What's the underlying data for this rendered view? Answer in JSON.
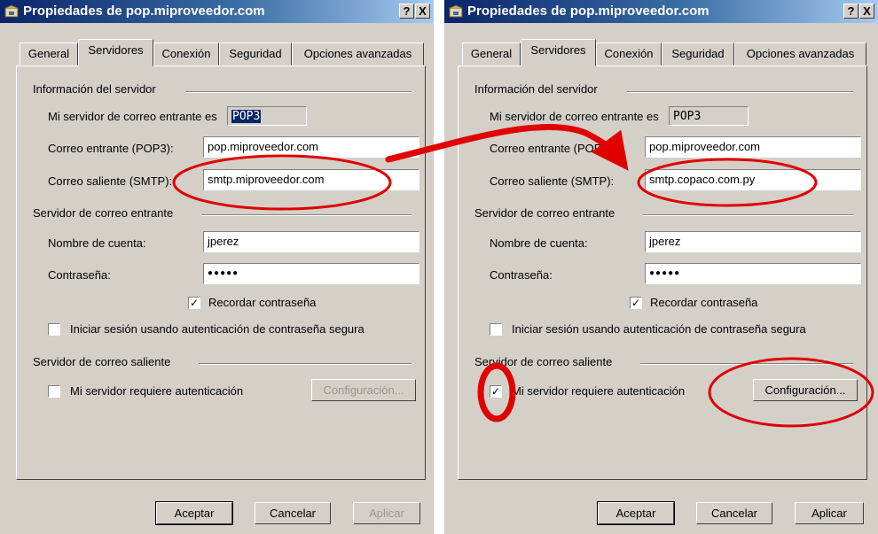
{
  "dialogs": [
    {
      "title": "Propiedades de pop.miproveedor.com",
      "help_btn": "?",
      "close_btn": "X",
      "tabs": [
        "General",
        "Servidores",
        "Conexión",
        "Seguridad",
        "Opciones avanzadas"
      ],
      "active_tab": "Servidores",
      "server_info_label": "Información del servidor",
      "incoming_type_label": "Mi servidor de correo entrante es",
      "incoming_type_value": "POP3",
      "pop3_label": "Correo entrante (POP3):",
      "pop3_value": "pop.miproveedor.com",
      "smtp_label": "Correo saliente (SMTP):",
      "smtp_value": "smtp.miproveedor.com",
      "incoming_server_label": "Servidor de correo entrante",
      "account_label": "Nombre de cuenta:",
      "account_value": "jperez",
      "password_label": "Contraseña:",
      "password_value": "●●●●●",
      "remember_label": "Recordar contraseña",
      "remember_checked": true,
      "spa_label": "Iniciar sesión usando autenticación de contraseña segura",
      "spa_checked": false,
      "outgoing_server_label": "Servidor de correo saliente",
      "auth_label": "Mi servidor requiere autenticación",
      "auth_checked": false,
      "config_btn": "Configuración...",
      "config_enabled": false,
      "ok_btn": "Aceptar",
      "cancel_btn": "Cancelar",
      "apply_btn": "Aplicar",
      "apply_enabled": false
    },
    {
      "title": "Propiedades de pop.miproveedor.com",
      "help_btn": "?",
      "close_btn": "X",
      "tabs": [
        "General",
        "Servidores",
        "Conexión",
        "Seguridad",
        "Opciones avanzadas"
      ],
      "active_tab": "Servidores",
      "server_info_label": "Información del servidor",
      "incoming_type_label": "Mi servidor de correo entrante es",
      "incoming_type_value": "POP3",
      "pop3_label": "Correo entrante (POP3):",
      "pop3_value": "pop.miproveedor.com",
      "smtp_label": "Correo saliente (SMTP):",
      "smtp_value": "smtp.copaco.com.py",
      "incoming_server_label": "Servidor de correo entrante",
      "account_label": "Nombre de cuenta:",
      "account_value": "jperez",
      "password_label": "Contraseña:",
      "password_value": "●●●●●",
      "remember_label": "Recordar contraseña",
      "remember_checked": true,
      "spa_label": "Iniciar sesión usando autenticación de contraseña segura",
      "spa_checked": false,
      "outgoing_server_label": "Servidor de correo saliente",
      "auth_label": "Mi servidor requiere autenticación",
      "auth_checked": true,
      "config_btn": "Configuración...",
      "config_enabled": true,
      "ok_btn": "Aceptar",
      "cancel_btn": "Cancelar",
      "apply_btn": "Aplicar",
      "apply_enabled": true
    }
  ],
  "check_mark": "✓",
  "annotation_color": "#e00000",
  "icons": [
    "app-icon",
    "help-icon",
    "close-icon",
    "annotation-arrow",
    "annotation-ellipse"
  ]
}
